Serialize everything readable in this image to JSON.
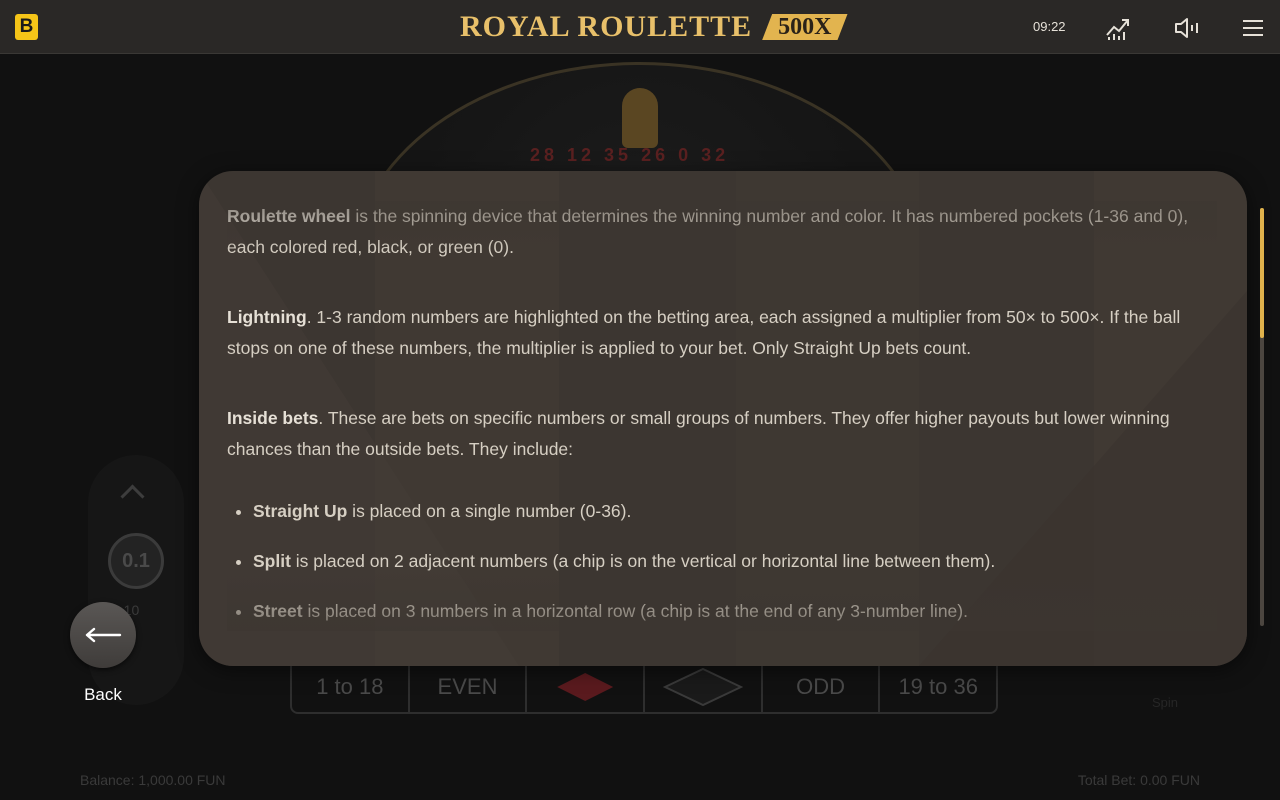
{
  "header": {
    "logo_letter": "B",
    "title": "ROYAL ROULETTE",
    "badge": "500X",
    "clock": "09:22",
    "icons": [
      "stats-icon",
      "sound-icon",
      "menu-icon"
    ]
  },
  "background": {
    "wheel_numbers": "28 12 35   26 0 32",
    "chip_value": "0.1",
    "chip_sub": "0.10",
    "chip_currency": "FUN",
    "bet_row": [
      "1 to 18",
      "EVEN",
      "",
      "",
      "ODD",
      "19 to 36"
    ],
    "bet_row_colors": {
      "red": "#5a1a1e",
      "black": "#1e1e1e"
    },
    "balance": "Balance: 1,000.00 FUN",
    "total_bet": "Total Bet: 0.00 FUN",
    "spin_label": "Spin"
  },
  "back": {
    "label": "Back"
  },
  "rules": {
    "p1_term": "Roulette wheel",
    "p1_text": " is the spinning device that determines the winning number and color. It has numbered pockets (1-36 and 0), each colored red, black, or green (0).",
    "p2_term": "Lightning",
    "p2_text": ". 1-3 random numbers are highlighted on the betting area, each assigned a multiplier from 50× to 500×. If the ball stops on one of these numbers, the multiplier is applied to your bet. Only Straight Up bets count.",
    "p3_term": "Inside bets",
    "p3_text": ". These are bets on specific numbers or small groups of numbers. They offer higher payouts but lower winning chances than the outside bets. They include:",
    "items": [
      {
        "term": "Straight Up",
        "text": " is placed on a single number (0-36)."
      },
      {
        "term": "Split",
        "text": " is placed on 2 adjacent numbers (a chip is on the vertical or horizontal line between them)."
      },
      {
        "term": "Street",
        "text": " is placed on 3 numbers in a horizontal row (a chip is at the end of any 3-number line)."
      }
    ]
  },
  "colors": {
    "accent": "#e0b24c",
    "modal_bg": "#3c3631",
    "topbar": "#2a2826"
  }
}
